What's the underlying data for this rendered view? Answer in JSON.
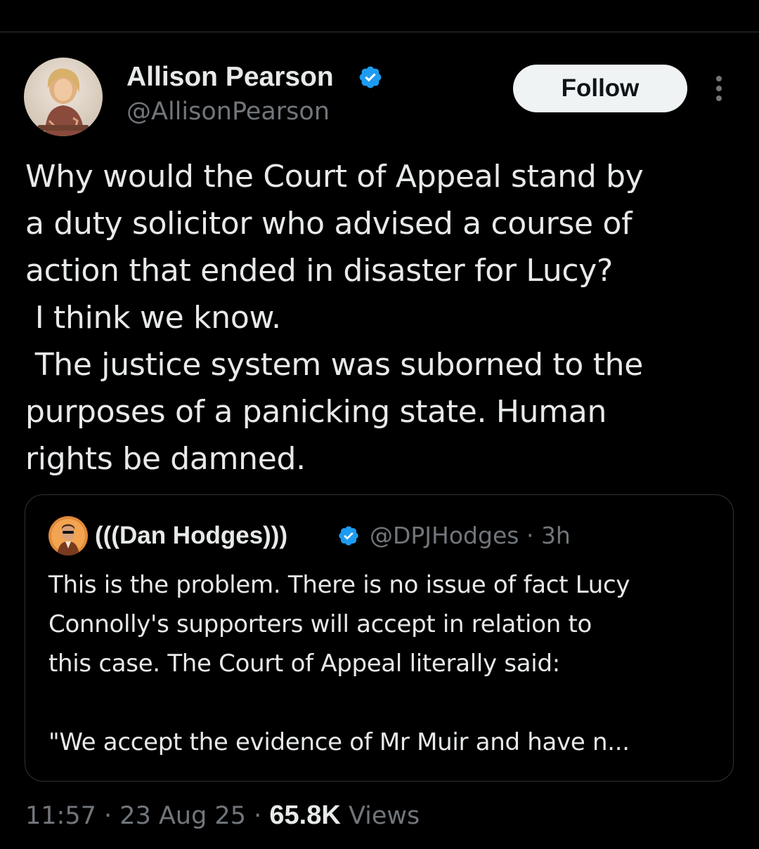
{
  "tweet": {
    "author": {
      "name": "Allison Pearson",
      "handle": "@AllisonPearson",
      "verified": true
    },
    "follow_label": "Follow",
    "text": "Why would the Court of Appeal stand by\na duty solicitor who advised a course of\naction that ended in disaster for Lucy?\n I think we know.\n The justice system was suborned to the\npurposes of a panicking state. Human\nrights be damned.",
    "quoted": {
      "name": "(((Dan Hodges)))",
      "handle": "@DPJHodges",
      "separator": "·",
      "time": "3h",
      "verified": true,
      "text": "This is the problem. There is no issue of fact Lucy\nConnolly's supporters will accept in relation to\nthis case. The Court of Appeal literally said:\n\n\"We accept the evidence of Mr Muir and have n..."
    },
    "meta": {
      "time": "11:57",
      "separator": "·",
      "date": "23 Aug 25",
      "views_count": "65.8K",
      "views_label": "Views"
    }
  },
  "colors": {
    "background": "#000000",
    "primary_text": "#e7e9ea",
    "secondary_text": "#71767b",
    "verified_badge": "#1d9bf0",
    "border": "#2f3336",
    "follow_button_bg": "#eff3f4"
  },
  "icons": {
    "verified": "verified-badge-icon",
    "more": "more-options-icon"
  }
}
